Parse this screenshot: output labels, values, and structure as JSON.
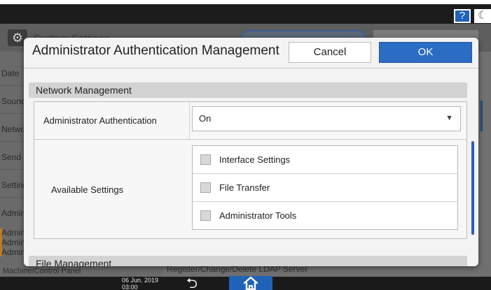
{
  "background": {
    "help_label": "?",
    "title": "System Settings",
    "sidebar_items": [
      "Date",
      "Sound",
      "Network",
      "Send",
      "Settings",
      "Administrator",
      "Administrator",
      "Administrator",
      "Administrator"
    ],
    "footer_left": "Machine/Control Panel",
    "footer_mid": "Register/Change/Delete LDAP Server",
    "date": "06 Jun. 2019",
    "time": "03:00"
  },
  "dialog": {
    "title": "Administrator Authentication Management",
    "cancel_label": "Cancel",
    "ok_label": "OK",
    "section_network": "Network Management",
    "auth_label": "Administrator Authentication",
    "auth_value": "On",
    "available_label": "Available Settings",
    "checks": [
      {
        "label": "Interface Settings",
        "checked": false
      },
      {
        "label": "File Transfer",
        "checked": false
      },
      {
        "label": "Administrator Tools",
        "checked": false
      }
    ],
    "section_file": "File Management"
  },
  "colors": {
    "accent_blue": "#2b6cc4",
    "dark_bar": "#1a1a1a"
  }
}
